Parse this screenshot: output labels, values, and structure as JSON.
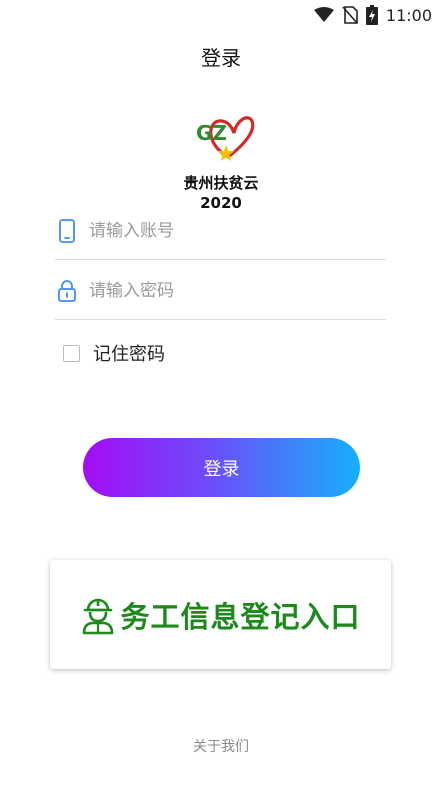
{
  "status_bar": {
    "time": "11:00",
    "icons": [
      "wifi-icon",
      "no-sim-icon",
      "battery-charging-icon"
    ]
  },
  "header": {
    "title": "登录"
  },
  "brand": {
    "logo_text": "GZ",
    "name": "贵州扶贫云",
    "year": "2020",
    "colors": {
      "logo_green": "#2e8b2e",
      "logo_red": "#d12a2a",
      "logo_star": "#f2c200"
    }
  },
  "form": {
    "account": {
      "icon": "phone-icon",
      "value": "",
      "placeholder": "请输入账号"
    },
    "password": {
      "icon": "lock-icon",
      "value": "",
      "placeholder": "请输入密码"
    },
    "remember": {
      "label": "记住密码",
      "checked": false
    }
  },
  "login_button": {
    "label": "登录",
    "gradient": [
      "#a40cf6",
      "#17b0fb"
    ]
  },
  "worker_entry": {
    "icon": "worker-helmet-icon",
    "label": "务工信息登记入口",
    "color": "#1b8a1b"
  },
  "footer": {
    "about_label": "关于我们"
  }
}
